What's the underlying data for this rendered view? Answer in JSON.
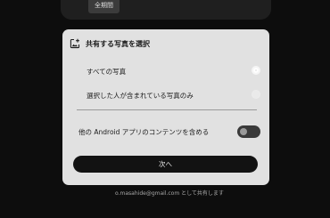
{
  "top_panel": {
    "period_chip": "全期間"
  },
  "share_sheet": {
    "title": "共有する写真を選択",
    "header_icon": "add-photo-icon",
    "options": [
      {
        "label": "すべての写真",
        "selected": true
      },
      {
        "label": "選択した人が含まれている写真のみ",
        "selected": false
      }
    ],
    "toggle": {
      "label": "他の Android アプリのコンテンツを含める",
      "on": false
    },
    "next_button": "次へ"
  },
  "footer": {
    "share_as": "o.masahide@gmail.com として共有します"
  }
}
